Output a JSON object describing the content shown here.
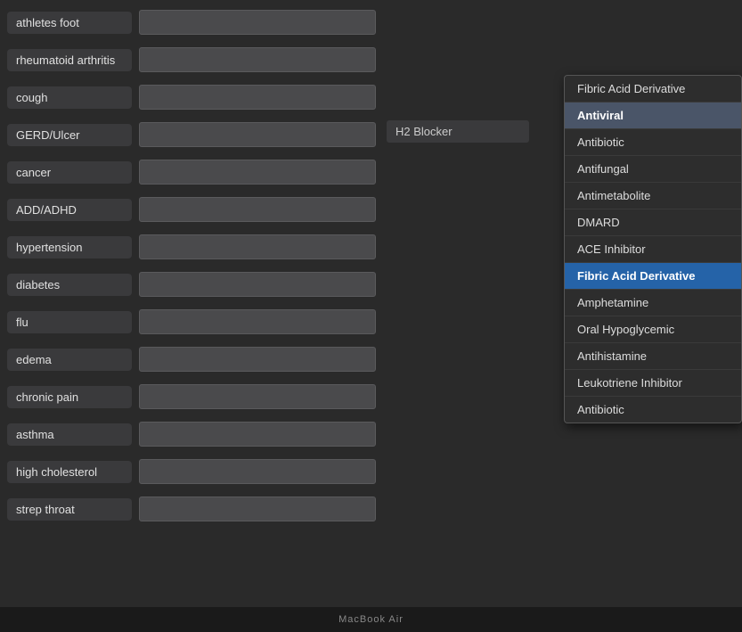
{
  "conditions": [
    {
      "label": "athletes foot",
      "hasInput": true,
      "rightContent": "empty"
    },
    {
      "label": "rheumatoid arthritis",
      "hasInput": true,
      "rightContent": "empty"
    },
    {
      "label": "cough",
      "hasInput": true,
      "rightContent": "empty"
    },
    {
      "label": "GERD/Ulcer",
      "hasInput": true,
      "rightContent": "label",
      "rightLabel": "H2 Blocker"
    },
    {
      "label": "cancer",
      "hasInput": true,
      "rightContent": "dropdown-start"
    },
    {
      "label": "ADD/ADHD",
      "hasInput": true,
      "rightContent": "in-dropdown"
    },
    {
      "label": "hypertension",
      "hasInput": true,
      "rightContent": "in-dropdown"
    },
    {
      "label": "diabetes",
      "hasInput": true,
      "rightContent": "in-dropdown"
    },
    {
      "label": "flu",
      "hasInput": true,
      "rightContent": "in-dropdown"
    },
    {
      "label": "edema",
      "hasInput": true,
      "rightContent": "in-dropdown"
    },
    {
      "label": "chronic pain",
      "hasInput": true,
      "rightContent": "in-dropdown"
    },
    {
      "label": "asthma",
      "hasInput": true,
      "rightContent": "empty"
    },
    {
      "label": "high cholesterol",
      "hasInput": true,
      "rightContent": "empty"
    },
    {
      "label": "strep throat",
      "hasInput": true,
      "rightContent": "empty"
    }
  ],
  "dropdown": {
    "items": [
      {
        "label": "Fibric Acid Derivative",
        "state": "normal"
      },
      {
        "label": "Antiviral",
        "state": "selected-dark"
      },
      {
        "label": "Antibiotic",
        "state": "normal"
      },
      {
        "label": "Antifungal",
        "state": "normal"
      },
      {
        "label": "Antimetabolite",
        "state": "normal"
      },
      {
        "label": "DMARD",
        "state": "normal"
      },
      {
        "label": "ACE Inhibitor",
        "state": "normal"
      },
      {
        "label": "Fibric Acid Derivative",
        "state": "selected-blue"
      },
      {
        "label": "Amphetamine",
        "state": "normal"
      },
      {
        "label": "Oral Hypoglycemic",
        "state": "normal"
      },
      {
        "label": "Antihistamine",
        "state": "normal"
      },
      {
        "label": "Leukotriene Inhibitor",
        "state": "normal"
      },
      {
        "label": "Antibiotic",
        "state": "normal"
      }
    ]
  },
  "footer": {
    "text": "MacBook Air"
  }
}
